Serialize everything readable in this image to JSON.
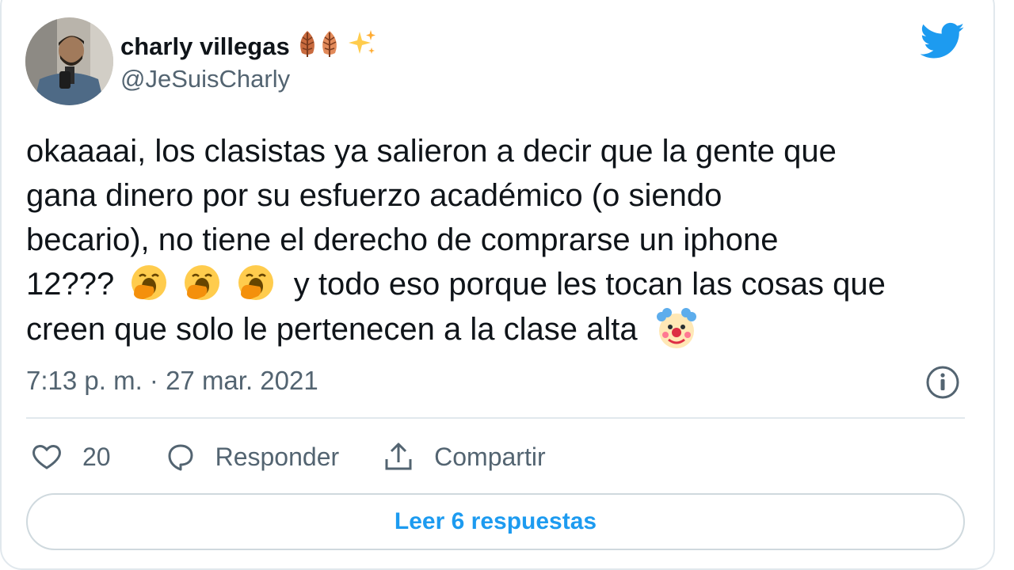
{
  "author": {
    "name": "charly villegas",
    "handle": "@JeSuisCharly",
    "name_emojis": [
      "leaf-emoji",
      "leaf-emoji",
      "sparkles-emoji"
    ]
  },
  "tweet": {
    "lines": [
      "okaaaai, los clasistas ya salieron a decir que la gente que",
      "gana dinero por su esfuerzo académico (o siendo",
      "becario), no tiene el derecho de comprarse un iphone",
      "12???",
      "y todo eso porque les tocan las cosas que",
      "creen que solo le pertenecen a la clase alta"
    ],
    "emojis": [
      "yawning-face-emoji",
      "yawning-face-emoji",
      "yawning-face-emoji",
      "clown-face-emoji"
    ],
    "timestamp": "7:13 p. m. · 27 mar. 2021"
  },
  "actions": {
    "like_count": "20",
    "reply_label": "Responder",
    "share_label": "Compartir"
  },
  "read_replies_label": "Leer 6 respuestas",
  "colors": {
    "twitter_blue": "#1d9bf0",
    "text_primary": "#0f1419",
    "text_secondary": "#536471",
    "border": "#e1e8ed"
  },
  "icons": [
    "twitter-bird-icon",
    "info-icon",
    "heart-icon",
    "reply-bubble-icon",
    "share-icon"
  ]
}
